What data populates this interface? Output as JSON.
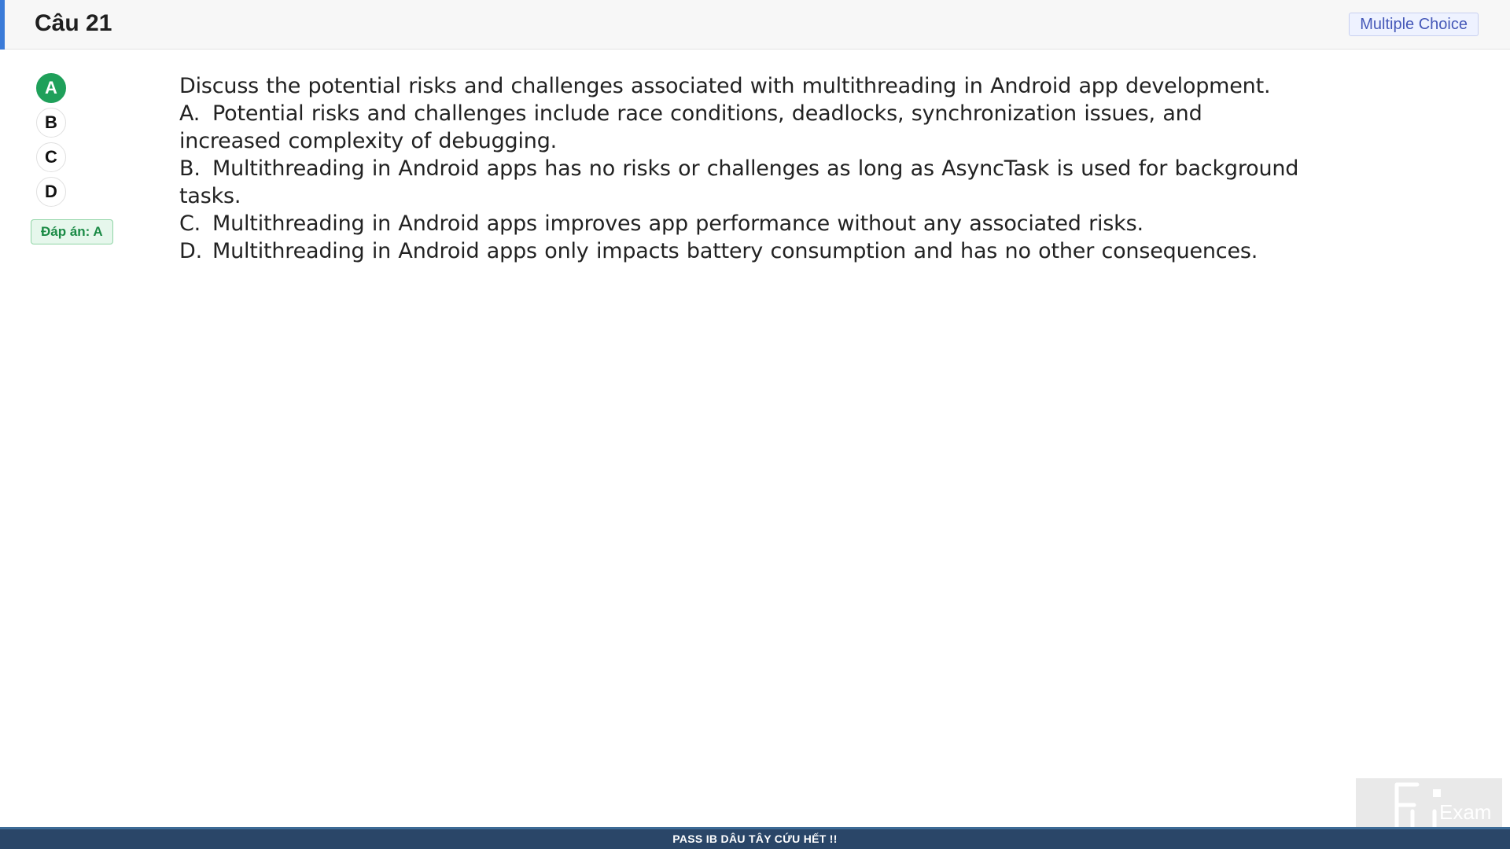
{
  "header": {
    "question_title": "Câu 21",
    "question_type": "Multiple Choice"
  },
  "options_nav": {
    "items": [
      "A",
      "B",
      "C",
      "D"
    ],
    "selected": "A",
    "answer_label": "Đáp án: A"
  },
  "question": {
    "stem": "Discuss the potential risks and challenges associated with multithreading in Android app development.",
    "choices": [
      {
        "letter": "A.",
        "text": "Potential risks and challenges include race conditions, deadlocks, synchronization issues, and increased complexity of debugging."
      },
      {
        "letter": "B.",
        "text": "Multithreading in Android apps has no risks or challenges as long as AsyncTask is used for background tasks."
      },
      {
        "letter": "C.",
        "text": "Multithreading in Android apps improves app performance without any associated risks."
      },
      {
        "letter": "D.",
        "text": "Multithreading in Android apps only impacts battery consumption and has no other consequences."
      }
    ]
  },
  "footer": {
    "text": "PASS IB DÂU TÂY CỨU HẾT !!"
  },
  "logo": {
    "text": "Exam",
    "icon": "fu-exam-logo"
  },
  "colors": {
    "accent": "#3b7bd8",
    "correct": "#1fa05a",
    "footer_bg": "#2a4668"
  }
}
